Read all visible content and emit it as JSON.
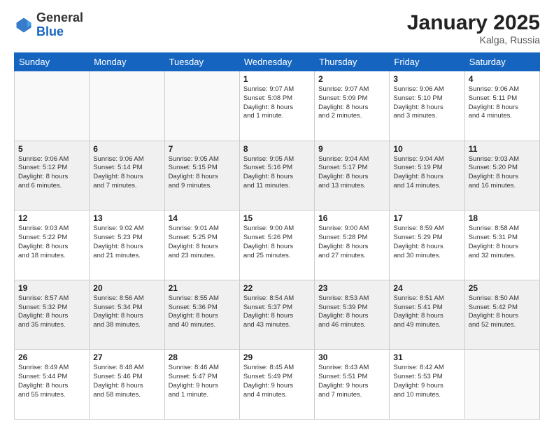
{
  "header": {
    "logo_general": "General",
    "logo_blue": "Blue",
    "month": "January 2025",
    "location": "Kalga, Russia"
  },
  "days_of_week": [
    "Sunday",
    "Monday",
    "Tuesday",
    "Wednesday",
    "Thursday",
    "Friday",
    "Saturday"
  ],
  "weeks": [
    [
      {
        "day": "",
        "info": ""
      },
      {
        "day": "",
        "info": ""
      },
      {
        "day": "",
        "info": ""
      },
      {
        "day": "1",
        "info": "Sunrise: 9:07 AM\nSunset: 5:08 PM\nDaylight: 8 hours\nand 1 minute."
      },
      {
        "day": "2",
        "info": "Sunrise: 9:07 AM\nSunset: 5:09 PM\nDaylight: 8 hours\nand 2 minutes."
      },
      {
        "day": "3",
        "info": "Sunrise: 9:06 AM\nSunset: 5:10 PM\nDaylight: 8 hours\nand 3 minutes."
      },
      {
        "day": "4",
        "info": "Sunrise: 9:06 AM\nSunset: 5:11 PM\nDaylight: 8 hours\nand 4 minutes."
      }
    ],
    [
      {
        "day": "5",
        "info": "Sunrise: 9:06 AM\nSunset: 5:12 PM\nDaylight: 8 hours\nand 6 minutes."
      },
      {
        "day": "6",
        "info": "Sunrise: 9:06 AM\nSunset: 5:14 PM\nDaylight: 8 hours\nand 7 minutes."
      },
      {
        "day": "7",
        "info": "Sunrise: 9:05 AM\nSunset: 5:15 PM\nDaylight: 8 hours\nand 9 minutes."
      },
      {
        "day": "8",
        "info": "Sunrise: 9:05 AM\nSunset: 5:16 PM\nDaylight: 8 hours\nand 11 minutes."
      },
      {
        "day": "9",
        "info": "Sunrise: 9:04 AM\nSunset: 5:17 PM\nDaylight: 8 hours\nand 13 minutes."
      },
      {
        "day": "10",
        "info": "Sunrise: 9:04 AM\nSunset: 5:19 PM\nDaylight: 8 hours\nand 14 minutes."
      },
      {
        "day": "11",
        "info": "Sunrise: 9:03 AM\nSunset: 5:20 PM\nDaylight: 8 hours\nand 16 minutes."
      }
    ],
    [
      {
        "day": "12",
        "info": "Sunrise: 9:03 AM\nSunset: 5:22 PM\nDaylight: 8 hours\nand 18 minutes."
      },
      {
        "day": "13",
        "info": "Sunrise: 9:02 AM\nSunset: 5:23 PM\nDaylight: 8 hours\nand 21 minutes."
      },
      {
        "day": "14",
        "info": "Sunrise: 9:01 AM\nSunset: 5:25 PM\nDaylight: 8 hours\nand 23 minutes."
      },
      {
        "day": "15",
        "info": "Sunrise: 9:00 AM\nSunset: 5:26 PM\nDaylight: 8 hours\nand 25 minutes."
      },
      {
        "day": "16",
        "info": "Sunrise: 9:00 AM\nSunset: 5:28 PM\nDaylight: 8 hours\nand 27 minutes."
      },
      {
        "day": "17",
        "info": "Sunrise: 8:59 AM\nSunset: 5:29 PM\nDaylight: 8 hours\nand 30 minutes."
      },
      {
        "day": "18",
        "info": "Sunrise: 8:58 AM\nSunset: 5:31 PM\nDaylight: 8 hours\nand 32 minutes."
      }
    ],
    [
      {
        "day": "19",
        "info": "Sunrise: 8:57 AM\nSunset: 5:32 PM\nDaylight: 8 hours\nand 35 minutes."
      },
      {
        "day": "20",
        "info": "Sunrise: 8:56 AM\nSunset: 5:34 PM\nDaylight: 8 hours\nand 38 minutes."
      },
      {
        "day": "21",
        "info": "Sunrise: 8:55 AM\nSunset: 5:36 PM\nDaylight: 8 hours\nand 40 minutes."
      },
      {
        "day": "22",
        "info": "Sunrise: 8:54 AM\nSunset: 5:37 PM\nDaylight: 8 hours\nand 43 minutes."
      },
      {
        "day": "23",
        "info": "Sunrise: 8:53 AM\nSunset: 5:39 PM\nDaylight: 8 hours\nand 46 minutes."
      },
      {
        "day": "24",
        "info": "Sunrise: 8:51 AM\nSunset: 5:41 PM\nDaylight: 8 hours\nand 49 minutes."
      },
      {
        "day": "25",
        "info": "Sunrise: 8:50 AM\nSunset: 5:42 PM\nDaylight: 8 hours\nand 52 minutes."
      }
    ],
    [
      {
        "day": "26",
        "info": "Sunrise: 8:49 AM\nSunset: 5:44 PM\nDaylight: 8 hours\nand 55 minutes."
      },
      {
        "day": "27",
        "info": "Sunrise: 8:48 AM\nSunset: 5:46 PM\nDaylight: 8 hours\nand 58 minutes."
      },
      {
        "day": "28",
        "info": "Sunrise: 8:46 AM\nSunset: 5:47 PM\nDaylight: 9 hours\nand 1 minute."
      },
      {
        "day": "29",
        "info": "Sunrise: 8:45 AM\nSunset: 5:49 PM\nDaylight: 9 hours\nand 4 minutes."
      },
      {
        "day": "30",
        "info": "Sunrise: 8:43 AM\nSunset: 5:51 PM\nDaylight: 9 hours\nand 7 minutes."
      },
      {
        "day": "31",
        "info": "Sunrise: 8:42 AM\nSunset: 5:53 PM\nDaylight: 9 hours\nand 10 minutes."
      },
      {
        "day": "",
        "info": ""
      }
    ]
  ]
}
